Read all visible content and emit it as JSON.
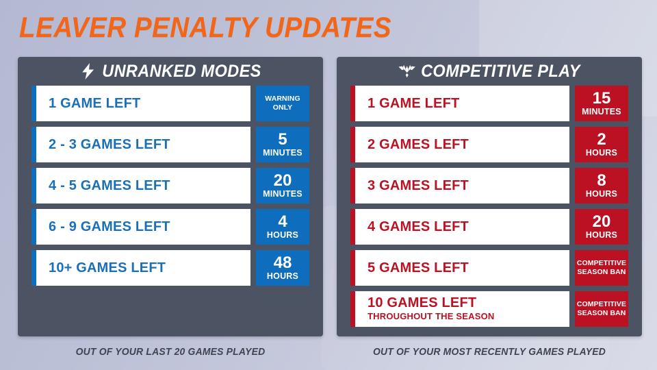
{
  "title": "LEAVER PENALTY UPDATES",
  "theme": {
    "background": "#b9bdd5",
    "panel": "#4c5463",
    "accent_orange": "#f2661a",
    "accent_blue": "#0f6dbd",
    "accent_red": "#bb1122",
    "row_background": "#ffffff",
    "footer_text": "#3e4452"
  },
  "panels": [
    {
      "id": "unranked",
      "header": "UNRANKED MODES",
      "header_icon": "lightning-bolt-icon",
      "footer": "OUT OF YOUR LAST 20 GAMES PLAYED",
      "color": "#0f6dbd",
      "rows": [
        {
          "label": "1 GAME LEFT",
          "sublabel": "",
          "badge_big": "",
          "badge_small": "",
          "badge_stack": "WARNING\nONLY"
        },
        {
          "label": "2 - 3 GAMES LEFT",
          "sublabel": "",
          "badge_big": "5",
          "badge_small": "MINUTES",
          "badge_stack": ""
        },
        {
          "label": "4 - 5 GAMES LEFT",
          "sublabel": "",
          "badge_big": "20",
          "badge_small": "MINUTES",
          "badge_stack": ""
        },
        {
          "label": "6 - 9 GAMES LEFT",
          "sublabel": "",
          "badge_big": "4",
          "badge_small": "HOURS",
          "badge_stack": ""
        },
        {
          "label": "10+ GAMES LEFT",
          "sublabel": "",
          "badge_big": "48",
          "badge_small": "HOURS",
          "badge_stack": ""
        }
      ]
    },
    {
      "id": "competitive",
      "header": "COMPETITIVE PLAY",
      "header_icon": "competitive-wings-icon",
      "footer": "OUT OF YOUR MOST RECENTLY GAMES PLAYED",
      "color": "#bb1122",
      "rows": [
        {
          "label": "1 GAME LEFT",
          "sublabel": "",
          "badge_big": "15",
          "badge_small": "MINUTES",
          "badge_stack": ""
        },
        {
          "label": "2 GAMES LEFT",
          "sublabel": "",
          "badge_big": "2",
          "badge_small": "HOURS",
          "badge_stack": ""
        },
        {
          "label": "3 GAMES LEFT",
          "sublabel": "",
          "badge_big": "8",
          "badge_small": "HOURS",
          "badge_stack": ""
        },
        {
          "label": "4 GAMES LEFT",
          "sublabel": "",
          "badge_big": "20",
          "badge_small": "HOURS",
          "badge_stack": ""
        },
        {
          "label": "5 GAMES LEFT",
          "sublabel": "",
          "badge_big": "",
          "badge_small": "",
          "badge_stack": "COMPETITIVE\nSEASON BAN"
        },
        {
          "label": "10 GAMES LEFT",
          "sublabel": "THROUGHOUT THE SEASON",
          "badge_big": "",
          "badge_small": "",
          "badge_stack": "COMPETITIVE\nSEASON BAN"
        }
      ]
    }
  ]
}
